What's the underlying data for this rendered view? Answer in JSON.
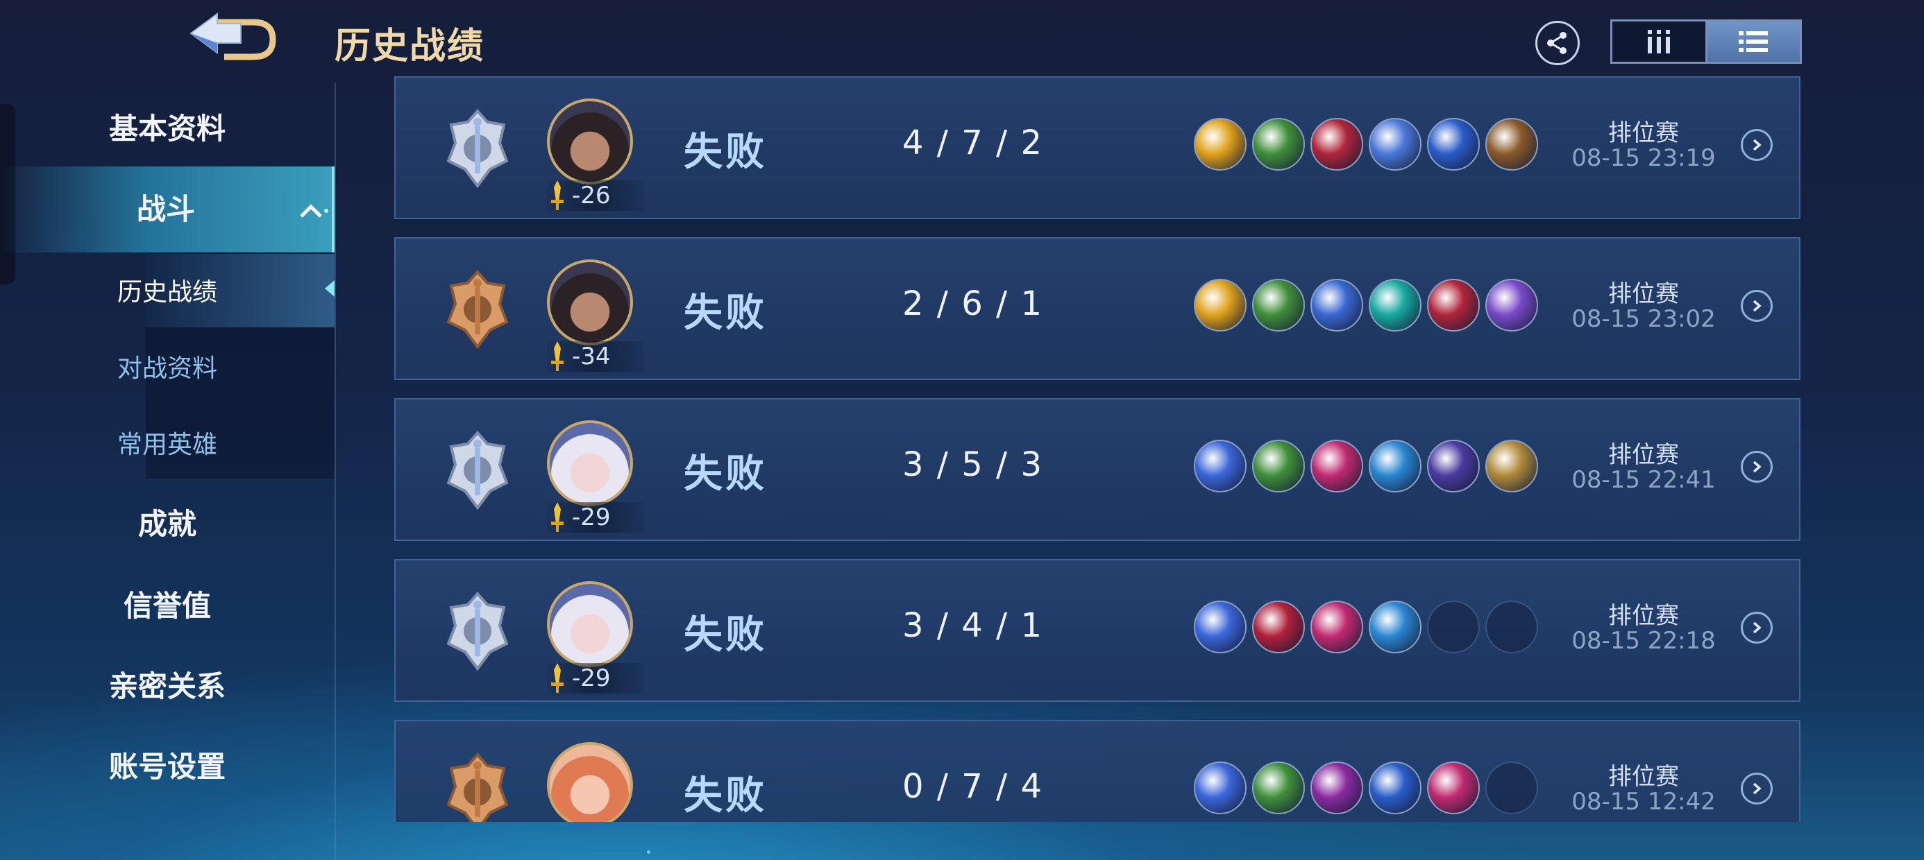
{
  "header": {
    "title": "历史战绩",
    "share_icon": "share-icon",
    "view_modes": [
      {
        "icon": "column-view-icon",
        "active": false
      },
      {
        "icon": "list-view-icon",
        "active": true
      }
    ]
  },
  "sidebar": {
    "items": [
      {
        "label": "基本资料"
      },
      {
        "label": "战斗",
        "expanded": true
      },
      {
        "label": "成就"
      },
      {
        "label": "信誉值"
      },
      {
        "label": "亲密关系"
      },
      {
        "label": "账号设置"
      }
    ],
    "sub_items": [
      {
        "label": "历史战绩",
        "current": true
      },
      {
        "label": "对战资料"
      },
      {
        "label": "常用英雄"
      }
    ]
  },
  "matches": [
    {
      "rank": "silver",
      "hero": "male-warrior",
      "score_change": "-26",
      "result": "失败",
      "kda": "4 / 7 / 2",
      "mode": "排位赛",
      "time": "08-15 23:19",
      "items": [
        "#e0a21c",
        "#3f8f3a",
        "#b0253a",
        "#4a78d8",
        "#2a5cc8",
        "#8a5a2a"
      ]
    },
    {
      "rank": "bronze",
      "hero": "male-warrior",
      "score_change": "-34",
      "result": "失败",
      "kda": "2 / 6 / 1",
      "mode": "排位赛",
      "time": "08-15 23:02",
      "items": [
        "#e0a21c",
        "#3f8f3a",
        "#3a68d0",
        "#18a8a0",
        "#b0253a",
        "#7a4ac8"
      ]
    },
    {
      "rank": "silver",
      "hero": "female-mage",
      "score_change": "-29",
      "result": "失败",
      "kda": "3 / 5 / 3",
      "mode": "排位赛",
      "time": "08-15 22:41",
      "items": [
        "#3a66d8",
        "#3f8f3a",
        "#c02a70",
        "#2a86d0",
        "#4a3aa0",
        "#b08a3a"
      ]
    },
    {
      "rank": "silver",
      "hero": "female-mage",
      "score_change": "-29",
      "result": "失败",
      "kda": "3 / 4 / 1",
      "mode": "排位赛",
      "time": "08-15 22:18",
      "items": [
        "#3a66d8",
        "#b0203a",
        "#c02a70",
        "#2a86d0",
        "",
        ""
      ]
    },
    {
      "rank": "bronze",
      "hero": "female-support",
      "score_change": "",
      "result": "失败",
      "kda": "0 / 7 / 4",
      "mode": "排位赛",
      "time": "08-15 12:42",
      "items": [
        "#3a66d8",
        "#3f8f3a",
        "#8a2aa0",
        "#2a5cc8",
        "#c02a70",
        ""
      ]
    }
  ]
}
